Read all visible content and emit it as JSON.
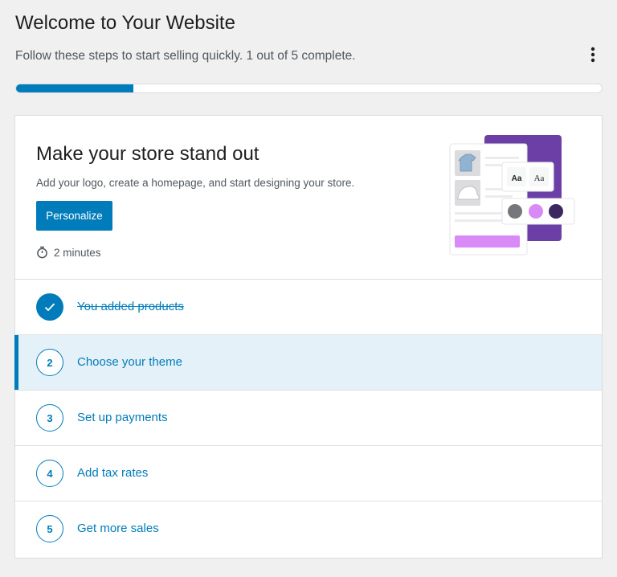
{
  "header": {
    "title": "Welcome to Your Website",
    "subtitle": "Follow these steps to start selling quickly. 1 out of 5 complete.",
    "more_icon": "vertical-ellipsis-icon",
    "progress": {
      "completed": 1,
      "total": 5,
      "fraction": 0.2
    }
  },
  "hero": {
    "title": "Make your store stand out",
    "description": "Add your logo, create a homepage, and start designing your store.",
    "button_label": "Personalize",
    "time_icon": "stopwatch-icon",
    "time_estimate": "2 minutes",
    "illustration": {
      "font_samples": [
        "Aa",
        "Aa"
      ],
      "swatch_colors": [
        "#75777c",
        "#d88af7",
        "#3c2861"
      ],
      "accent_color": "#6b3fa6"
    }
  },
  "tasks": [
    {
      "number": "1",
      "label": "You added products",
      "done": true,
      "active": false
    },
    {
      "number": "2",
      "label": "Choose your theme",
      "done": false,
      "active": true
    },
    {
      "number": "3",
      "label": "Set up payments",
      "done": false,
      "active": false
    },
    {
      "number": "4",
      "label": "Add tax rates",
      "done": false,
      "active": false
    },
    {
      "number": "5",
      "label": "Get more sales",
      "done": false,
      "active": false
    }
  ],
  "colors": {
    "accent": "#007cba",
    "background": "#f0f0f1",
    "active_row": "#e5f1f8"
  }
}
